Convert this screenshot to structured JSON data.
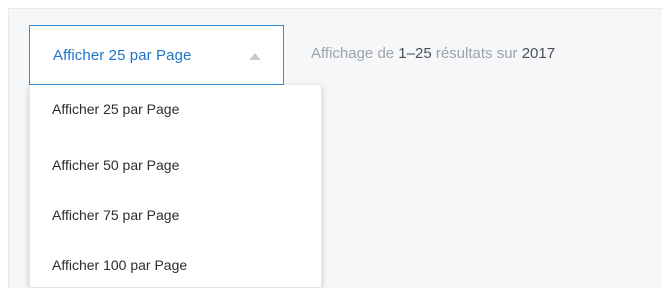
{
  "pagination": {
    "selected_label": "Afficher 25 par Page",
    "caret_icon": "caret-up-icon",
    "results": {
      "prefix": "Affichage de",
      "range": "1–25",
      "middle": "résultats sur",
      "total": "2017"
    },
    "options": [
      "Afficher 25 par Page",
      "Afficher 50 par Page",
      "Afficher 75 par Page",
      "Afficher 100 par Page"
    ]
  },
  "colors": {
    "accent": "#1f74c9",
    "border_accent": "#3a8bd6",
    "muted_text": "#9ea3aa"
  }
}
